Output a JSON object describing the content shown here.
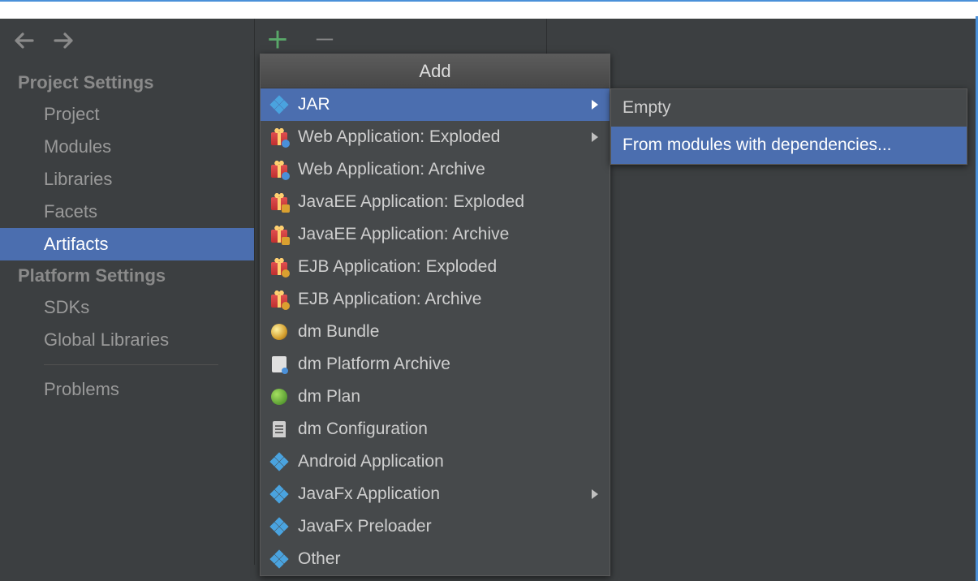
{
  "sidebar": {
    "section1_title": "Project Settings",
    "section2_title": "Platform Settings",
    "items1": [
      "Project",
      "Modules",
      "Libraries",
      "Facets",
      "Artifacts"
    ],
    "items2": [
      "SDKs",
      "Global Libraries"
    ],
    "problems": "Problems",
    "selected": "Artifacts"
  },
  "add_menu": {
    "title": "Add",
    "items": [
      {
        "label": "JAR",
        "icon": "module",
        "submenu": true,
        "selected": true
      },
      {
        "label": "Web Application: Exploded",
        "icon": "gift-globe",
        "submenu": true
      },
      {
        "label": "Web Application: Archive",
        "icon": "gift-globe"
      },
      {
        "label": "JavaEE Application: Exploded",
        "icon": "gift-ee"
      },
      {
        "label": "JavaEE Application: Archive",
        "icon": "gift-ee"
      },
      {
        "label": "EJB Application: Exploded",
        "icon": "gift-ejb"
      },
      {
        "label": "EJB Application: Archive",
        "icon": "gift-ejb"
      },
      {
        "label": "dm Bundle",
        "icon": "bundle"
      },
      {
        "label": "dm Platform Archive",
        "icon": "archive"
      },
      {
        "label": "dm Plan",
        "icon": "plan"
      },
      {
        "label": "dm Configuration",
        "icon": "config"
      },
      {
        "label": "Android Application",
        "icon": "module"
      },
      {
        "label": "JavaFx Application",
        "icon": "module",
        "submenu": true
      },
      {
        "label": "JavaFx Preloader",
        "icon": "module"
      },
      {
        "label": "Other",
        "icon": "module"
      }
    ]
  },
  "jar_submenu": {
    "items": [
      {
        "label": "Empty"
      },
      {
        "label": "From modules with dependencies...",
        "selected": true
      }
    ]
  }
}
